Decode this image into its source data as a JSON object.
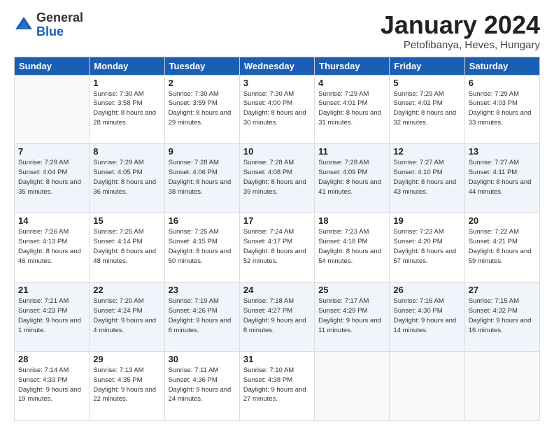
{
  "header": {
    "logo_general": "General",
    "logo_blue": "Blue",
    "month_title": "January 2024",
    "location": "Petofibanya, Heves, Hungary"
  },
  "weekdays": [
    "Sunday",
    "Monday",
    "Tuesday",
    "Wednesday",
    "Thursday",
    "Friday",
    "Saturday"
  ],
  "weeks": [
    [
      {
        "day": "",
        "sunrise": "",
        "sunset": "",
        "daylight": ""
      },
      {
        "day": "1",
        "sunrise": "Sunrise: 7:30 AM",
        "sunset": "Sunset: 3:58 PM",
        "daylight": "Daylight: 8 hours and 28 minutes."
      },
      {
        "day": "2",
        "sunrise": "Sunrise: 7:30 AM",
        "sunset": "Sunset: 3:59 PM",
        "daylight": "Daylight: 8 hours and 29 minutes."
      },
      {
        "day": "3",
        "sunrise": "Sunrise: 7:30 AM",
        "sunset": "Sunset: 4:00 PM",
        "daylight": "Daylight: 8 hours and 30 minutes."
      },
      {
        "day": "4",
        "sunrise": "Sunrise: 7:29 AM",
        "sunset": "Sunset: 4:01 PM",
        "daylight": "Daylight: 8 hours and 31 minutes."
      },
      {
        "day": "5",
        "sunrise": "Sunrise: 7:29 AM",
        "sunset": "Sunset: 4:02 PM",
        "daylight": "Daylight: 8 hours and 32 minutes."
      },
      {
        "day": "6",
        "sunrise": "Sunrise: 7:29 AM",
        "sunset": "Sunset: 4:03 PM",
        "daylight": "Daylight: 8 hours and 33 minutes."
      }
    ],
    [
      {
        "day": "7",
        "sunrise": "Sunrise: 7:29 AM",
        "sunset": "Sunset: 4:04 PM",
        "daylight": "Daylight: 8 hours and 35 minutes."
      },
      {
        "day": "8",
        "sunrise": "Sunrise: 7:29 AM",
        "sunset": "Sunset: 4:05 PM",
        "daylight": "Daylight: 8 hours and 36 minutes."
      },
      {
        "day": "9",
        "sunrise": "Sunrise: 7:28 AM",
        "sunset": "Sunset: 4:06 PM",
        "daylight": "Daylight: 8 hours and 38 minutes."
      },
      {
        "day": "10",
        "sunrise": "Sunrise: 7:28 AM",
        "sunset": "Sunset: 4:08 PM",
        "daylight": "Daylight: 8 hours and 39 minutes."
      },
      {
        "day": "11",
        "sunrise": "Sunrise: 7:28 AM",
        "sunset": "Sunset: 4:09 PM",
        "daylight": "Daylight: 8 hours and 41 minutes."
      },
      {
        "day": "12",
        "sunrise": "Sunrise: 7:27 AM",
        "sunset": "Sunset: 4:10 PM",
        "daylight": "Daylight: 8 hours and 43 minutes."
      },
      {
        "day": "13",
        "sunrise": "Sunrise: 7:27 AM",
        "sunset": "Sunset: 4:11 PM",
        "daylight": "Daylight: 8 hours and 44 minutes."
      }
    ],
    [
      {
        "day": "14",
        "sunrise": "Sunrise: 7:26 AM",
        "sunset": "Sunset: 4:13 PM",
        "daylight": "Daylight: 8 hours and 46 minutes."
      },
      {
        "day": "15",
        "sunrise": "Sunrise: 7:25 AM",
        "sunset": "Sunset: 4:14 PM",
        "daylight": "Daylight: 8 hours and 48 minutes."
      },
      {
        "day": "16",
        "sunrise": "Sunrise: 7:25 AM",
        "sunset": "Sunset: 4:15 PM",
        "daylight": "Daylight: 8 hours and 50 minutes."
      },
      {
        "day": "17",
        "sunrise": "Sunrise: 7:24 AM",
        "sunset": "Sunset: 4:17 PM",
        "daylight": "Daylight: 8 hours and 52 minutes."
      },
      {
        "day": "18",
        "sunrise": "Sunrise: 7:23 AM",
        "sunset": "Sunset: 4:18 PM",
        "daylight": "Daylight: 8 hours and 54 minutes."
      },
      {
        "day": "19",
        "sunrise": "Sunrise: 7:23 AM",
        "sunset": "Sunset: 4:20 PM",
        "daylight": "Daylight: 8 hours and 57 minutes."
      },
      {
        "day": "20",
        "sunrise": "Sunrise: 7:22 AM",
        "sunset": "Sunset: 4:21 PM",
        "daylight": "Daylight: 8 hours and 59 minutes."
      }
    ],
    [
      {
        "day": "21",
        "sunrise": "Sunrise: 7:21 AM",
        "sunset": "Sunset: 4:23 PM",
        "daylight": "Daylight: 9 hours and 1 minute."
      },
      {
        "day": "22",
        "sunrise": "Sunrise: 7:20 AM",
        "sunset": "Sunset: 4:24 PM",
        "daylight": "Daylight: 9 hours and 4 minutes."
      },
      {
        "day": "23",
        "sunrise": "Sunrise: 7:19 AM",
        "sunset": "Sunset: 4:26 PM",
        "daylight": "Daylight: 9 hours and 6 minutes."
      },
      {
        "day": "24",
        "sunrise": "Sunrise: 7:18 AM",
        "sunset": "Sunset: 4:27 PM",
        "daylight": "Daylight: 9 hours and 8 minutes."
      },
      {
        "day": "25",
        "sunrise": "Sunrise: 7:17 AM",
        "sunset": "Sunset: 4:29 PM",
        "daylight": "Daylight: 9 hours and 11 minutes."
      },
      {
        "day": "26",
        "sunrise": "Sunrise: 7:16 AM",
        "sunset": "Sunset: 4:30 PM",
        "daylight": "Daylight: 9 hours and 14 minutes."
      },
      {
        "day": "27",
        "sunrise": "Sunrise: 7:15 AM",
        "sunset": "Sunset: 4:32 PM",
        "daylight": "Daylight: 9 hours and 16 minutes."
      }
    ],
    [
      {
        "day": "28",
        "sunrise": "Sunrise: 7:14 AM",
        "sunset": "Sunset: 4:33 PM",
        "daylight": "Daylight: 9 hours and 19 minutes."
      },
      {
        "day": "29",
        "sunrise": "Sunrise: 7:13 AM",
        "sunset": "Sunset: 4:35 PM",
        "daylight": "Daylight: 9 hours and 22 minutes."
      },
      {
        "day": "30",
        "sunrise": "Sunrise: 7:11 AM",
        "sunset": "Sunset: 4:36 PM",
        "daylight": "Daylight: 9 hours and 24 minutes."
      },
      {
        "day": "31",
        "sunrise": "Sunrise: 7:10 AM",
        "sunset": "Sunset: 4:38 PM",
        "daylight": "Daylight: 9 hours and 27 minutes."
      },
      {
        "day": "",
        "sunrise": "",
        "sunset": "",
        "daylight": ""
      },
      {
        "day": "",
        "sunrise": "",
        "sunset": "",
        "daylight": ""
      },
      {
        "day": "",
        "sunrise": "",
        "sunset": "",
        "daylight": ""
      }
    ]
  ]
}
